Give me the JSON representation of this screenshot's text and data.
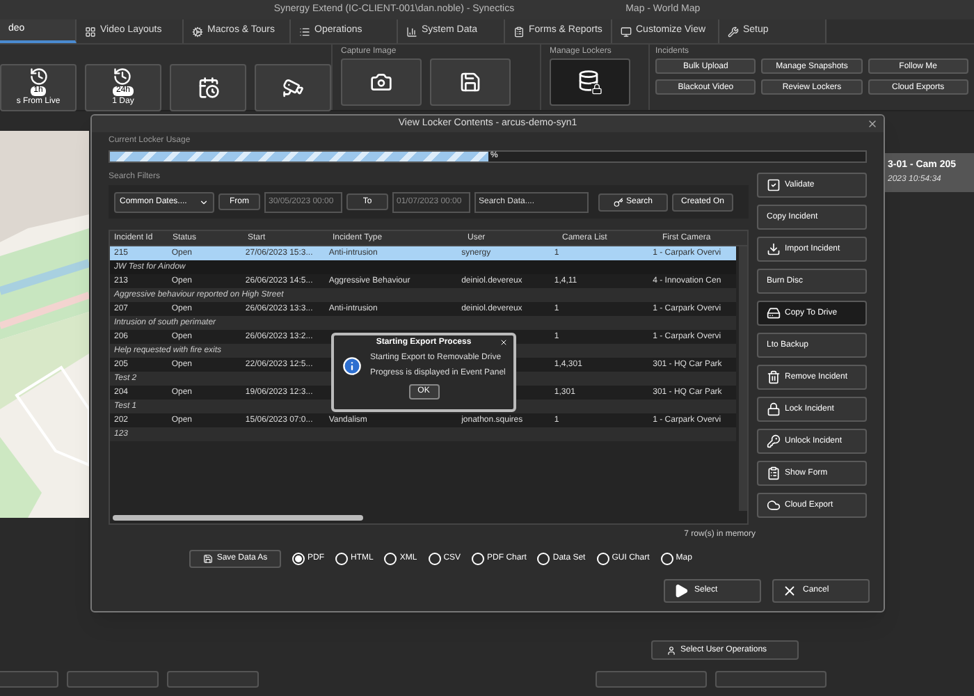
{
  "window": {
    "title": "Synergy Extend (IC-CLIENT-001\\dan.noble) - Synectics",
    "subtitle": "Map - World Map"
  },
  "tabs": [
    {
      "label": "deo",
      "selected": true
    },
    {
      "label": "Video Layouts",
      "selected": false
    },
    {
      "label": "Macros & Tours",
      "selected": false
    },
    {
      "label": "Operations",
      "selected": false
    },
    {
      "label": "System Data",
      "selected": false
    },
    {
      "label": "Forms & Reports",
      "selected": false
    },
    {
      "label": "Customize View",
      "selected": false
    },
    {
      "label": "Setup",
      "selected": false
    }
  ],
  "ribbon": {
    "playback_buttons": [
      {
        "badge": "1h",
        "label": "s From Live"
      },
      {
        "badge": "24h",
        "label": "1 Day"
      }
    ],
    "capture_image": {
      "title": "Capture Image"
    },
    "manage_lockers": {
      "title": "Manage Lockers",
      "selected": true
    },
    "incidents": {
      "title": "Incidents",
      "buttons": [
        "Bulk Upload",
        "Manage Snapshots",
        "Follow Me",
        "Blackout Video",
        "Review Lockers",
        "Cloud Exports"
      ]
    }
  },
  "event_panel": {
    "camera": "3-01 - Cam 205",
    "time": "2023 10:54:34"
  },
  "select_user_operations": "Select User Operations",
  "dialog": {
    "title": "View Locker Contents - arcus-demo-syn1",
    "usage": {
      "label": "Current Locker Usage",
      "level": 0.5,
      "unit": "%"
    },
    "filters": {
      "label": "Search Filters",
      "dropdown": "Common Dates....",
      "from": "From",
      "from_date": "30/05/2023 00:00",
      "to": "To",
      "to_date": "01/07/2023 00:00",
      "search_placeholder": "Search Data....",
      "search": "Search",
      "created": "Created On"
    },
    "table": {
      "columns": [
        "Incident Id",
        "Status",
        "Start",
        "Incident Type",
        "User",
        "Camera List",
        "First Camera"
      ],
      "rows": [
        {
          "id": "215",
          "status": "Open",
          "start": "27/06/2023 15:3...",
          "type": "Anti-intrusion",
          "user": "synergy",
          "cameras": "1",
          "first_camera": "1 - Carpark Overvi",
          "note": "JW Test for Aindow",
          "selected": true
        },
        {
          "id": "213",
          "status": "Open",
          "start": "26/06/2023 14:5...",
          "type": "Aggressive Behaviour",
          "user": "deiniol.devereux",
          "cameras": "1,4,11",
          "first_camera": "4 - Innovation Cen",
          "note": "Aggressive behaviour reported on High Street",
          "selected": false
        },
        {
          "id": "207",
          "status": "Open",
          "start": "26/06/2023 13:3...",
          "type": "Anti-intrusion",
          "user": "deiniol.devereux",
          "cameras": "1",
          "first_camera": "1 - Carpark Overvi",
          "note": "Intrusion of south perimater",
          "selected": false
        },
        {
          "id": "206",
          "status": "Open",
          "start": "26/06/2023 13:2...",
          "cameras": "1",
          "first_camera": "1 - Carpark Overvi",
          "note": "Help requested with fire exits",
          "selected": false
        },
        {
          "id": "205",
          "status": "Open",
          "start": "22/06/2023 12:5...",
          "cameras": "1,4,301",
          "first_camera": "301 - HQ Car Park",
          "note": "Test 2",
          "selected": false
        },
        {
          "id": "204",
          "status": "Open",
          "start": "19/06/2023 12:3...",
          "cameras": "1,301",
          "first_camera": "301 - HQ Car Park",
          "note": "Test 1",
          "selected": false
        },
        {
          "id": "202",
          "status": "Open",
          "start": "15/06/2023 07:0...",
          "type": "Vandalism",
          "user": "jonathon.squires",
          "cameras": "1",
          "first_camera": "1 - Carpark Overvi",
          "note": "123",
          "selected": false
        }
      ]
    },
    "row_count": "7 row(s) in memory",
    "actions": [
      {
        "label": "Validate",
        "selected": false
      },
      {
        "label": "Copy Incident",
        "selected": false
      },
      {
        "label": "Import Incident",
        "selected": false
      },
      {
        "label": "Burn Disc",
        "selected": false
      },
      {
        "label": "Copy To Drive",
        "selected": true
      },
      {
        "label": "Lto Backup",
        "selected": false
      },
      {
        "label": "Remove Incident",
        "selected": false
      },
      {
        "label": "Lock Incident",
        "selected": false
      },
      {
        "label": "Unlock Incident",
        "selected": false
      },
      {
        "label": "Show Form",
        "selected": false
      },
      {
        "label": "Cloud Export",
        "selected": false
      }
    ],
    "save_as": "Save Data As",
    "export_formats": [
      {
        "label": "PDF",
        "selected": true
      },
      {
        "label": "HTML",
        "selected": false
      },
      {
        "label": "XML",
        "selected": false
      },
      {
        "label": "CSV",
        "selected": false
      },
      {
        "label": "PDF Chart",
        "selected": false
      },
      {
        "label": "Data Set",
        "selected": false
      },
      {
        "label": "GUI Chart",
        "selected": false
      },
      {
        "label": "Map",
        "selected": false
      }
    ],
    "select": "Select",
    "cancel": "Cancel"
  },
  "message_box": {
    "title": "Starting Export Process",
    "lines": [
      "Starting Export to Removable Drive",
      "Progress is displayed in Event Panel"
    ],
    "ok": "OK"
  }
}
